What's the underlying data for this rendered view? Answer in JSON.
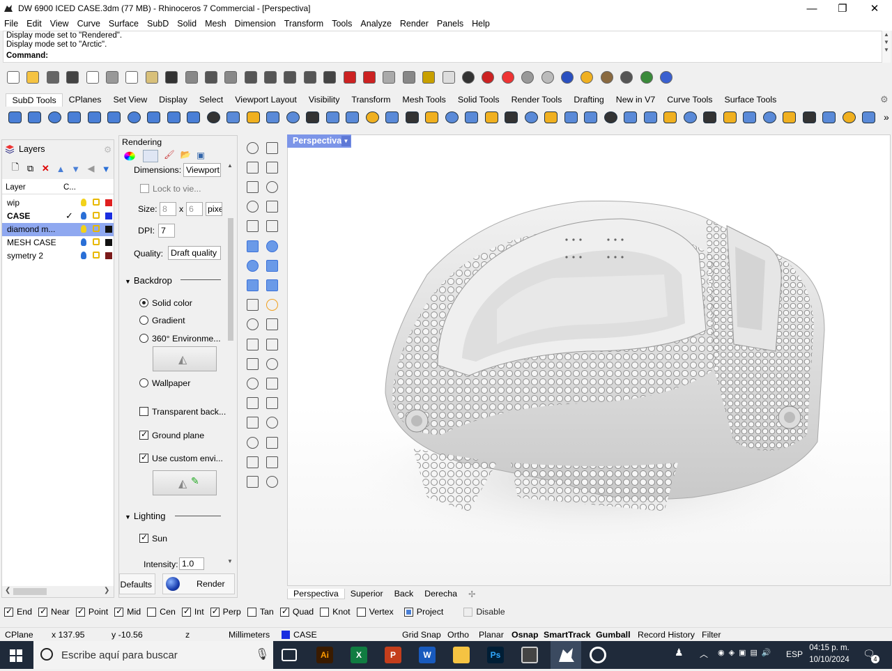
{
  "window": {
    "title": "DW 6900 ICED CASE.3dm (77 MB) - Rhinoceros 7 Commercial - [Perspectiva]",
    "minimize": "—",
    "maximize": "❐",
    "close": "✕"
  },
  "menu": [
    "File",
    "Edit",
    "View",
    "Curve",
    "Surface",
    "SubD",
    "Solid",
    "Mesh",
    "Dimension",
    "Transform",
    "Tools",
    "Analyze",
    "Render",
    "Panels",
    "Help"
  ],
  "command": {
    "history": [
      "Display mode set to \"Rendered\".",
      "Display mode set to \"Arctic\"."
    ],
    "prompt": "Command:"
  },
  "toolbar_tabs": [
    "SubD Tools",
    "CPlanes",
    "Set View",
    "Display",
    "Select",
    "Viewport Layout",
    "Visibility",
    "Transform",
    "Mesh Tools",
    "Solid Tools",
    "Render Tools",
    "Drafting",
    "New in V7",
    "Curve Tools",
    "Surface Tools"
  ],
  "layers": {
    "panel_title": "Layers",
    "col_layer": "Layer",
    "col_current": "C...",
    "rows": [
      {
        "name": "wip",
        "current": "",
        "color": "#e02020",
        "selected": false,
        "bold": false
      },
      {
        "name": "CASE",
        "current": "✓",
        "color": "#1a2ee0",
        "selected": false,
        "bold": true
      },
      {
        "name": "diamond m...",
        "current": "",
        "color": "#111111",
        "selected": true,
        "bold": false
      },
      {
        "name": "MESH CASE",
        "current": "",
        "color": "#111111",
        "selected": false,
        "bold": false
      },
      {
        "name": "symetry 2",
        "current": "",
        "color": "#7a1a1a",
        "selected": false,
        "bold": false
      }
    ]
  },
  "rendering": {
    "panel_title": "Rendering",
    "dimensions_label": "Dimensions:",
    "dimensions_value": "Viewport",
    "lock_label": "Lock to vie...",
    "size_label": "Size:",
    "size_w": "8",
    "size_x": "x",
    "size_h": "6",
    "size_unit": "pixe",
    "dpi_label": "DPI:",
    "dpi_value": "7",
    "quality_label": "Quality:",
    "quality_value": "Draft quality",
    "backdrop": "Backdrop",
    "solid_color": "Solid color",
    "gradient": "Gradient",
    "env360": "360° Environme...",
    "wallpaper": "Wallpaper",
    "transparent": "Transparent back...",
    "ground_plane": "Ground plane",
    "custom_env": "Use custom envi...",
    "lighting": "Lighting",
    "sun": "Sun",
    "intensity_label": "Intensity:",
    "intensity_value": "1.0",
    "defaults_btn": "Defaults",
    "render_btn": "Render"
  },
  "viewport": {
    "title": "Perspectiva",
    "tabs": [
      "Perspectiva",
      "Superior",
      "Back",
      "Derecha"
    ],
    "add": "✢"
  },
  "osnap": [
    {
      "label": "End",
      "checked": true
    },
    {
      "label": "Near",
      "checked": true
    },
    {
      "label": "Point",
      "checked": true
    },
    {
      "label": "Mid",
      "checked": true
    },
    {
      "label": "Cen",
      "checked": false
    },
    {
      "label": "Int",
      "checked": true
    },
    {
      "label": "Perp",
      "checked": true
    },
    {
      "label": "Tan",
      "checked": false
    },
    {
      "label": "Quad",
      "checked": true
    },
    {
      "label": "Knot",
      "checked": false
    },
    {
      "label": "Vertex",
      "checked": false
    },
    {
      "label": "Project",
      "checked": true
    },
    {
      "label": "Disable",
      "checked": false
    }
  ],
  "status": {
    "cplane": "CPlane",
    "x": "x 137.95",
    "y": "y -10.56",
    "z": "z",
    "units": "Millimeters",
    "layer": "CASE",
    "layer_color": "#1a2ee0",
    "toggles": [
      {
        "label": "Grid Snap",
        "bold": false
      },
      {
        "label": "Ortho",
        "bold": false
      },
      {
        "label": "Planar",
        "bold": false
      },
      {
        "label": "Osnap",
        "bold": true
      },
      {
        "label": "SmartTrack",
        "bold": true
      },
      {
        "label": "Gumball",
        "bold": true
      },
      {
        "label": "Record History",
        "bold": false
      },
      {
        "label": "Filter",
        "bold": false
      }
    ]
  },
  "taskbar": {
    "search_placeholder": "Escribe aquí para buscar",
    "lang": "ESP",
    "time": "04:15 p. m.",
    "date": "10/10/2024",
    "notif": "4"
  }
}
